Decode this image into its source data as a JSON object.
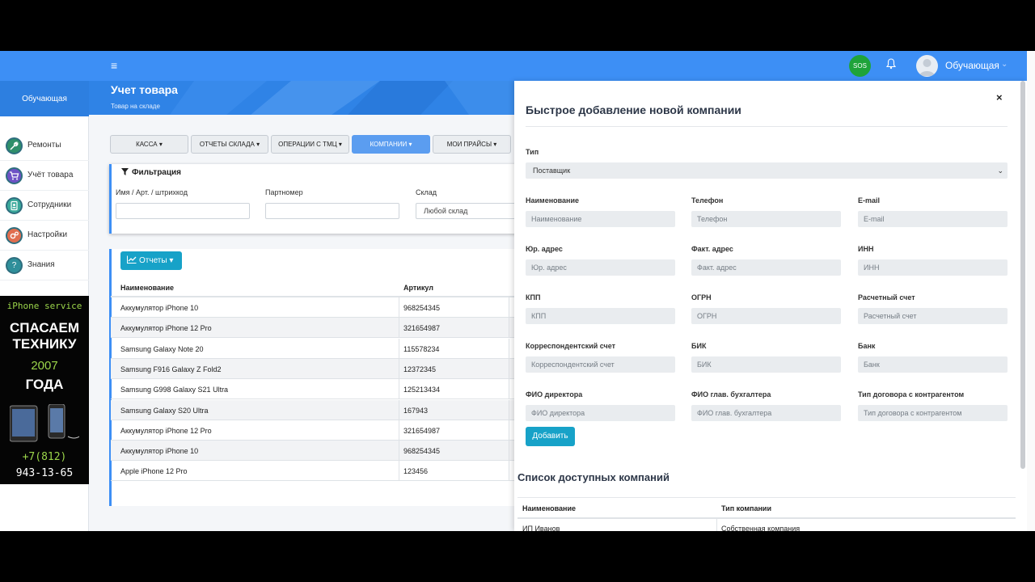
{
  "topbar": {
    "hamburger": "≡",
    "sos": "SOS",
    "user_name": "Обучающая",
    "caret": "⌄"
  },
  "sidebar": {
    "brand": "Обучающая",
    "items": [
      {
        "label": "Ремонты",
        "icon": "wrench-icon",
        "color": "#2f8f6a"
      },
      {
        "label": "Учёт товара",
        "icon": "cart-icon",
        "color": "#6e52c5"
      },
      {
        "label": "Сотрудники",
        "icon": "badge-icon",
        "color": "#3aa89a"
      },
      {
        "label": "Настройки",
        "icon": "gears-icon",
        "color": "#e06e4f"
      },
      {
        "label": "Знания",
        "icon": "question-icon",
        "color": "#2f8f9a"
      }
    ]
  },
  "ad": {
    "brand": "iPhone service",
    "title": "СПАСАЕМ ТЕХНИКУ",
    "year": "2007",
    "tag": "ГОДА",
    "phone_line1": "+7(812)",
    "phone_line2": "943-13-65"
  },
  "header": {
    "title": "Учет товара",
    "subtitle": "Товар на складе"
  },
  "menu": {
    "kassa": "КАССА",
    "reports_sklad": "ОТЧЕТЫ СКЛАДА",
    "operations": "ОПЕРАЦИИ С ТМЦ",
    "companies": "КОМПАНИИ",
    "prices": "МОИ ПРАЙСЫ"
  },
  "filter": {
    "title": "Фильтрация",
    "name_label": "Имя / Арт. / штрихкод",
    "part_label": "Партномер",
    "sklad_label": "Склад",
    "sklad_value": "Любой склад"
  },
  "reports": {
    "button_label": "Отчеты",
    "col_name": "Наименование",
    "col_art": "Артикул",
    "rows": [
      {
        "name": "Аккумулятор iPhone 10",
        "art": "968254345"
      },
      {
        "name": "Аккумулятор iPhone 12 Pro",
        "art": "321654987"
      },
      {
        "name": "Samsung Galaxy Note 20",
        "art": "115578234"
      },
      {
        "name": "Samsung F916 Galaxy Z Fold2",
        "art": "12372345"
      },
      {
        "name": "Samsung G998 Galaxy S21 Ultra",
        "art": "125213434"
      },
      {
        "name": "Samsung Galaxy S20 Ultra",
        "art": "167943"
      },
      {
        "name": "Аккумулятор iPhone 12 Pro",
        "art": "321654987"
      },
      {
        "name": "Аккумулятор iPhone 10",
        "art": "968254345"
      },
      {
        "name": "Apple iPhone 12 Pro",
        "art": "123456"
      }
    ]
  },
  "modal": {
    "title": "Быстрое добавление новой компании",
    "close": "×",
    "type_label": "Тип",
    "type_value": "Поставщик",
    "fields": [
      {
        "label": "Наименование",
        "placeholder": "Наименование"
      },
      {
        "label": "Телефон",
        "placeholder": "Телефон"
      },
      {
        "label": "E-mail",
        "placeholder": "E-mail"
      },
      {
        "label": "Юр. адрес",
        "placeholder": "Юр. адрес"
      },
      {
        "label": "Факт. адрес",
        "placeholder": "Факт. адрес"
      },
      {
        "label": "ИНН",
        "placeholder": "ИНН"
      },
      {
        "label": "КПП",
        "placeholder": "КПП"
      },
      {
        "label": "ОГРН",
        "placeholder": "ОГРН"
      },
      {
        "label": "Расчетный счет",
        "placeholder": "Расчетный счет"
      },
      {
        "label": "Корреспондентский счет",
        "placeholder": "Корреспондентский счет"
      },
      {
        "label": "БИК",
        "placeholder": "БИК"
      },
      {
        "label": "Банк",
        "placeholder": "Банк"
      },
      {
        "label": "ФИО директора",
        "placeholder": "ФИО директора"
      },
      {
        "label": "ФИО глав. бухгалтера",
        "placeholder": "ФИО глав. бухгалтера"
      },
      {
        "label": "Тип договора с контрагентом",
        "placeholder": "Тип договора с контрагентом"
      }
    ],
    "add_button": "Добавить",
    "list_title": "Список доступных компаний",
    "list_col_name": "Наименование",
    "list_col_type": "Тип компании",
    "list_row_name": "ИП Иванов",
    "list_row_type": "Собственная компания"
  },
  "colors": {
    "navbar": "#3d8ff5",
    "accent": "#17a2c8",
    "sos": "#1fa33a"
  }
}
